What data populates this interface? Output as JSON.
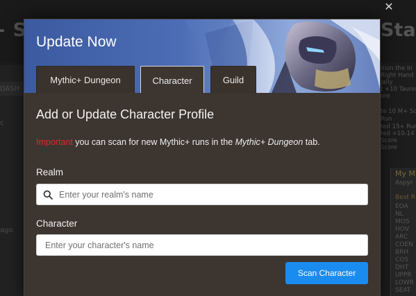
{
  "background": {
    "heading_left": "- Se",
    "heading_right": "Stat",
    "left_labels": [
      "DASH",
      "c",
      "ago"
    ],
    "right_lines": [
      "ition the In",
      "Right Hand",
      "Jally",
      "t  +10 Tauren",
      "ore",
      "te 10 M+ Sc",
      "Run",
      "ted 15+ Runs",
      "ted +10-14 Ru",
      "Score",
      "Score"
    ],
    "panel_title": "My M",
    "panel_sub": "Aspyr",
    "panel_best": "Best R",
    "dungeons": [
      "EOA",
      "NL",
      "MOS",
      "HOV",
      "ARC",
      "COEN",
      "BRH",
      "COS",
      "DHT",
      "UPPR",
      "LOWR",
      "SEAT"
    ]
  },
  "modal": {
    "title": "Update Now",
    "tabs": [
      {
        "label": "Mythic+ Dungeon",
        "active": false
      },
      {
        "label": "Character",
        "active": true
      },
      {
        "label": "Guild",
        "active": false
      }
    ],
    "section_title": "Add or Update Character Profile",
    "note": {
      "important": "Important",
      "text_before": "you can scan for new Mythic+ runs in the",
      "emphasis": "Mythic+ Dungeon",
      "text_after": "tab."
    },
    "realm": {
      "label": "Realm",
      "placeholder": "Enter your realm's name",
      "value": ""
    },
    "character": {
      "label": "Character",
      "placeholder": "Enter your character's name",
      "value": ""
    },
    "scan_button": "Scan Character"
  },
  "colors": {
    "modal_bg": "#3d3530",
    "important": "#e0262b",
    "button": "#1a8cf0"
  },
  "icons": {
    "close": "close-icon",
    "search": "search-icon"
  }
}
